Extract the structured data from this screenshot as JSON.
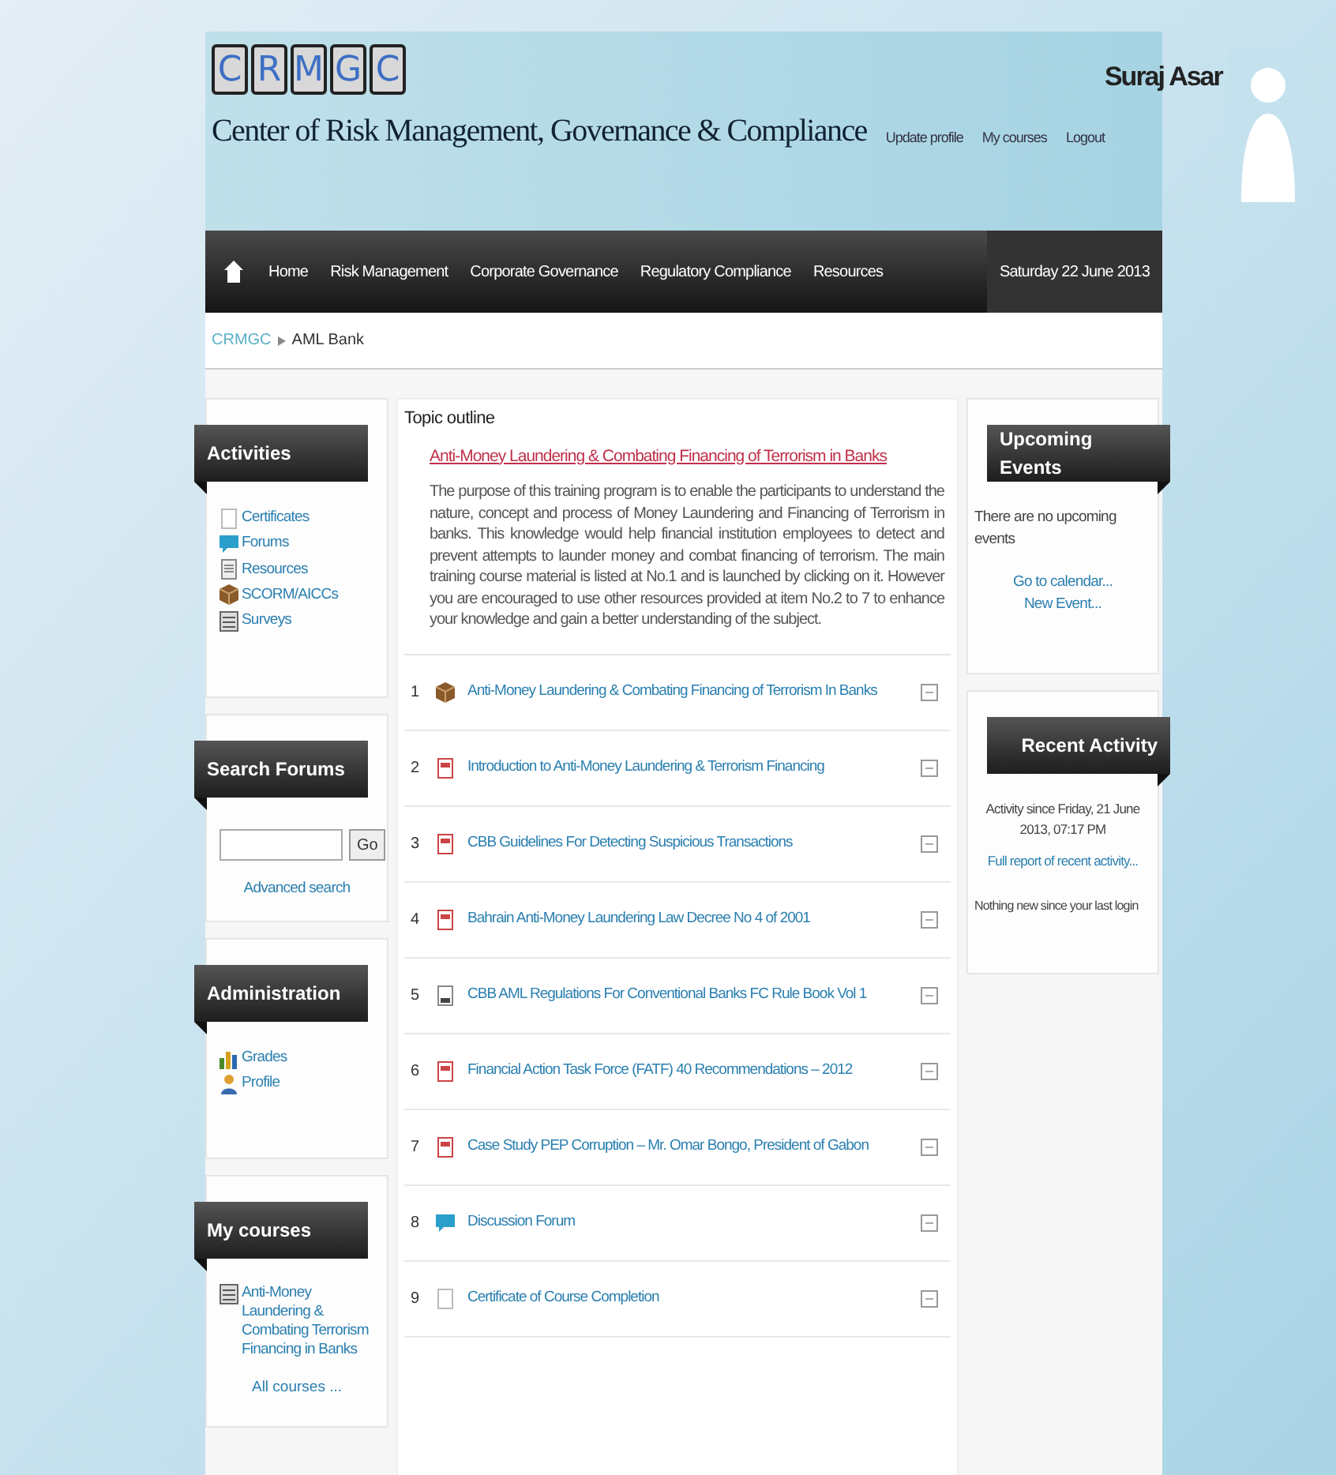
{
  "header": {
    "logo_letters": [
      "C",
      "R",
      "M",
      "G",
      "C"
    ],
    "site_title": "Center of Risk Management, Governance & Compliance",
    "user_name": "Suraj Asar",
    "user_links": [
      "Update profile",
      "My courses",
      "Logout"
    ]
  },
  "nav": {
    "items": [
      "Home",
      "Risk Management",
      "Corporate Governance",
      "Regulatory Compliance",
      "Resources"
    ],
    "date": "Saturday 22 June 2013"
  },
  "breadcrumb": [
    "CRMGC",
    "AML Bank"
  ],
  "activities": {
    "title": "Activities",
    "items": [
      {
        "label": "Certificates",
        "kind": "certificate"
      },
      {
        "label": "Forums",
        "kind": "forum"
      },
      {
        "label": "Resources",
        "kind": "resource"
      },
      {
        "label": "SCORM/AICCs",
        "kind": "scorm"
      },
      {
        "label": "Surveys",
        "kind": "survey"
      }
    ]
  },
  "search_forums": {
    "title": "Search Forums",
    "button": "Go",
    "link": "Advanced search"
  },
  "administration": {
    "title": "Administration",
    "items": [
      {
        "label": "Grades",
        "kind": "grades"
      },
      {
        "label": "Profile",
        "kind": "profile"
      }
    ]
  },
  "my_courses": {
    "title": "My courses",
    "courses": [
      "Anti-Money Laundering & Combating Terrorism Financing in Banks"
    ],
    "link": "All courses ..."
  },
  "topic_outline": {
    "heading": "Topic outline",
    "course_title": "Anti-Money Laundering & Combating Financing of Terrorism in Banks",
    "description": "The purpose of this training program is to enable the participants to understand the nature, concept and process of Money Laundering and Financing of Terrorism in banks. This knowledge would help financial institution employees to detect and prevent attempts to launder money and combat financing of terrorism. The main training course material is listed at No.1 and is launched by clicking on it. However you are encouraged to use other resources provided at item No.2 to 7 to enhance your knowledge and gain a better understanding of the subject.",
    "items": [
      {
        "number": "1",
        "label": "Anti-Money Laundering & Combating Financing of Terrorism In Banks",
        "kind": "scorm"
      },
      {
        "number": "2",
        "label": "Introduction to Anti-Money Laundering & Terrorism Financing",
        "kind": "pdf"
      },
      {
        "number": "3",
        "label": "CBB Guidelines For Detecting Suspicious Transactions",
        "kind": "pdf"
      },
      {
        "number": "4",
        "label": "Bahrain Anti-Money Laundering Law Decree No 4 of 2001",
        "kind": "pdf"
      },
      {
        "number": "5",
        "label": "CBB AML Regulations For Conventional Banks FC Rule Book Vol 1",
        "kind": "file"
      },
      {
        "number": "6",
        "label": "Financial Action Task Force (FATF) 40 Recommendations – 2012",
        "kind": "pdf"
      },
      {
        "number": "7",
        "label": "Case Study PEP Corruption – Mr. Omar Bongo, President of Gabon",
        "kind": "pdf"
      },
      {
        "number": "8",
        "label": "Discussion Forum",
        "kind": "forum"
      },
      {
        "number": "9",
        "label": "Certificate of Course Completion",
        "kind": "certificate"
      }
    ]
  },
  "upcoming_events": {
    "title": "Upcoming Events",
    "text": "There are no upcoming events",
    "links": [
      "Go to calendar...",
      "New Event..."
    ]
  },
  "recent_activity": {
    "title": "Recent Activity",
    "since": "Activity since Friday, 21 June 2013, 07:17 PM",
    "link": "Full report of recent activity...",
    "text": "Nothing new since your last login"
  }
}
